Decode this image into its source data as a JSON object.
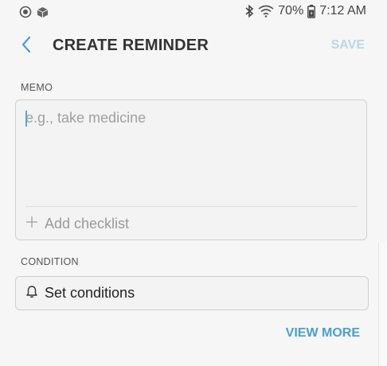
{
  "status_bar": {
    "battery_percent": "70%",
    "time": "7:12 AM",
    "left_icons": [
      "focus-icon",
      "package-icon"
    ],
    "right_icons": [
      "bluetooth-icon",
      "wifi-icon",
      "battery-icon"
    ]
  },
  "header": {
    "back_icon": "chevron-left-icon",
    "title": "CREATE REMINDER",
    "save_label": "SAVE"
  },
  "memo": {
    "label": "MEMO",
    "placeholder": "e.g., take medicine",
    "value": "",
    "checklist_label": "Add checklist",
    "checklist_icon": "plus-icon"
  },
  "condition": {
    "label": "CONDITION",
    "button_label": "Set conditions",
    "icon": "bell-icon"
  },
  "footer": {
    "view_more_label": "VIEW MORE"
  },
  "colors": {
    "accent": "#4b9fc9",
    "save_disabled": "#b6d8ea",
    "background": "#f6f6f6"
  }
}
